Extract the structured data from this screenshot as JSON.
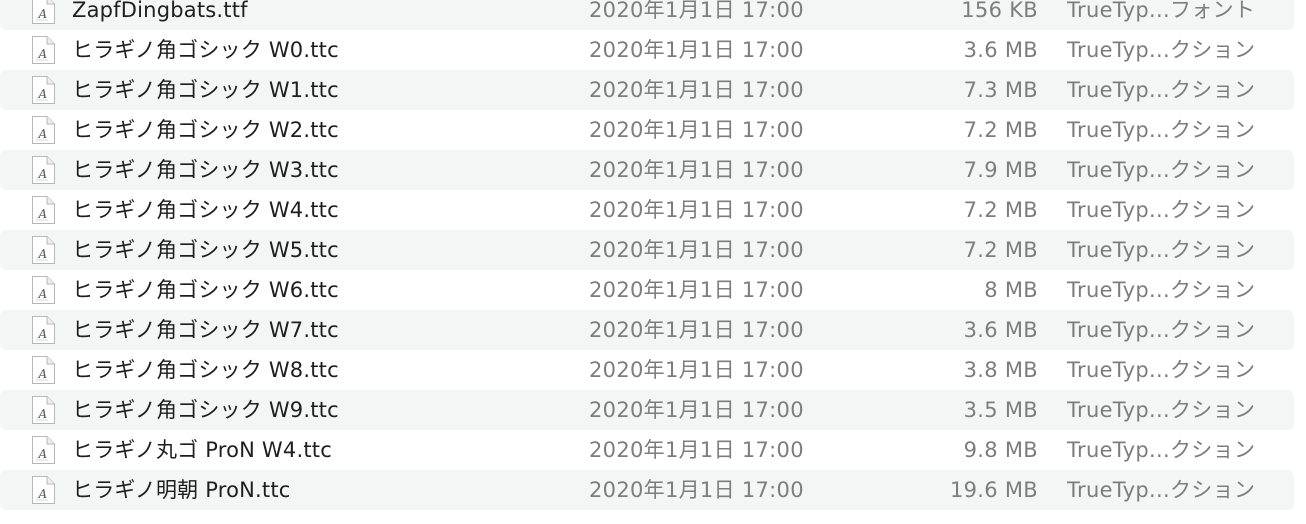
{
  "files": [
    {
      "icon": "font-file-icon",
      "name": "ZapfDingbats.ttf",
      "date": "2020年1月1日 17:00",
      "size": "156 KB",
      "kind": "TrueTyp...フォント"
    },
    {
      "icon": "font-file-icon",
      "name": "ヒラギノ角ゴシック W0.ttc",
      "date": "2020年1月1日 17:00",
      "size": "3.6 MB",
      "kind": "TrueTyp...クション"
    },
    {
      "icon": "font-file-icon",
      "name": "ヒラギノ角ゴシック W1.ttc",
      "date": "2020年1月1日 17:00",
      "size": "7.3 MB",
      "kind": "TrueTyp...クション"
    },
    {
      "icon": "font-file-icon",
      "name": "ヒラギノ角ゴシック W2.ttc",
      "date": "2020年1月1日 17:00",
      "size": "7.2 MB",
      "kind": "TrueTyp...クション"
    },
    {
      "icon": "font-file-icon",
      "name": "ヒラギノ角ゴシック W3.ttc",
      "date": "2020年1月1日 17:00",
      "size": "7.9 MB",
      "kind": "TrueTyp...クション"
    },
    {
      "icon": "font-file-icon",
      "name": "ヒラギノ角ゴシック W4.ttc",
      "date": "2020年1月1日 17:00",
      "size": "7.2 MB",
      "kind": "TrueTyp...クション"
    },
    {
      "icon": "font-file-icon",
      "name": "ヒラギノ角ゴシック W5.ttc",
      "date": "2020年1月1日 17:00",
      "size": "7.2 MB",
      "kind": "TrueTyp...クション"
    },
    {
      "icon": "font-file-icon",
      "name": "ヒラギノ角ゴシック W6.ttc",
      "date": "2020年1月1日 17:00",
      "size": "8 MB",
      "kind": "TrueTyp...クション"
    },
    {
      "icon": "font-file-icon",
      "name": "ヒラギノ角ゴシック W7.ttc",
      "date": "2020年1月1日 17:00",
      "size": "3.6 MB",
      "kind": "TrueTyp...クション"
    },
    {
      "icon": "font-file-icon",
      "name": "ヒラギノ角ゴシック W8.ttc",
      "date": "2020年1月1日 17:00",
      "size": "3.8 MB",
      "kind": "TrueTyp...クション"
    },
    {
      "icon": "font-file-icon",
      "name": "ヒラギノ角ゴシック W9.ttc",
      "date": "2020年1月1日 17:00",
      "size": "3.5 MB",
      "kind": "TrueTyp...クション"
    },
    {
      "icon": "font-file-icon",
      "name": "ヒラギノ丸ゴ ProN W4.ttc",
      "date": "2020年1月1日 17:00",
      "size": "9.8 MB",
      "kind": "TrueTyp...クション"
    },
    {
      "icon": "font-file-icon",
      "name": "ヒラギノ明朝 ProN.ttc",
      "date": "2020年1月1日 17:00",
      "size": "19.6 MB",
      "kind": "TrueTyp...クション"
    }
  ],
  "colors": {
    "row_alt": "#f4f5f5",
    "name_text": "#1e1e1e",
    "meta_text": "#7d7d7d"
  }
}
